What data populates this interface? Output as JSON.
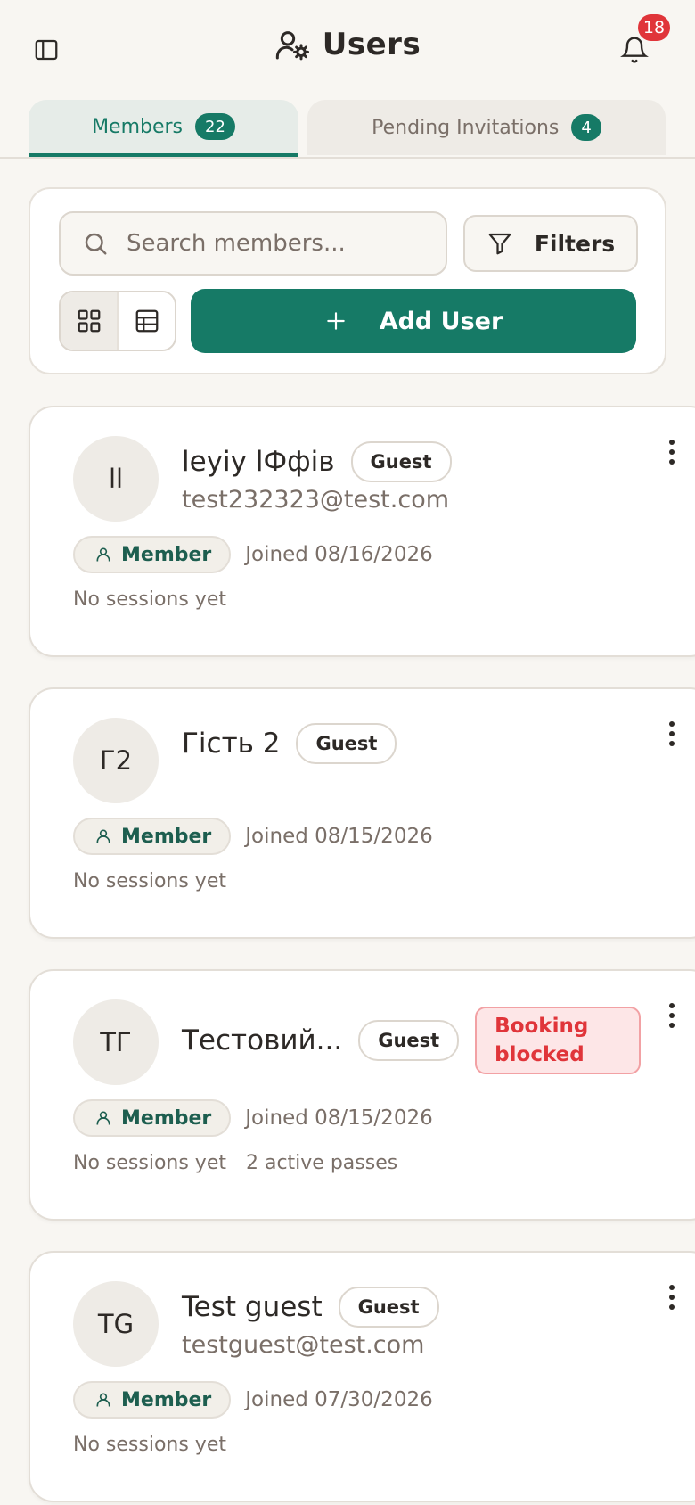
{
  "header": {
    "title": "Users",
    "notification_count": "18"
  },
  "tabs": [
    {
      "label": "Members",
      "count": "22",
      "active": true
    },
    {
      "label": "Pending Invitations",
      "count": "4",
      "active": false
    }
  ],
  "toolbar": {
    "search_placeholder": "Search members...",
    "filters_label": "Filters",
    "add_user_label": "Add User",
    "view_mode": "grid"
  },
  "members": [
    {
      "initials": "ll",
      "name": "leyiy lФфів",
      "badge": "Guest",
      "email": "test232323@test.com",
      "role": "Member",
      "joined": "Joined 08/16/2026",
      "sessions": "No sessions yet",
      "passes": "",
      "blocked": ""
    },
    {
      "initials": "Г2",
      "name": "Гість 2",
      "badge": "Guest",
      "email": "",
      "role": "Member",
      "joined": "Joined 08/15/2026",
      "sessions": "No sessions yet",
      "passes": "",
      "blocked": ""
    },
    {
      "initials": "ТГ",
      "name": "Тестовий...",
      "badge": "Guest",
      "email": "",
      "role": "Member",
      "joined": "Joined 08/15/2026",
      "sessions": "No sessions yet",
      "passes": "2 active passes",
      "blocked": "Booking blocked"
    },
    {
      "initials": "TG",
      "name": "Test guest",
      "badge": "Guest",
      "email": "testguest@test.com",
      "role": "Member",
      "joined": "Joined 07/30/2026",
      "sessions": "No sessions yet",
      "passes": "",
      "blocked": ""
    }
  ],
  "colors": {
    "accent": "#167a66",
    "background": "#f8f6f2",
    "danger": "#e0353a"
  }
}
